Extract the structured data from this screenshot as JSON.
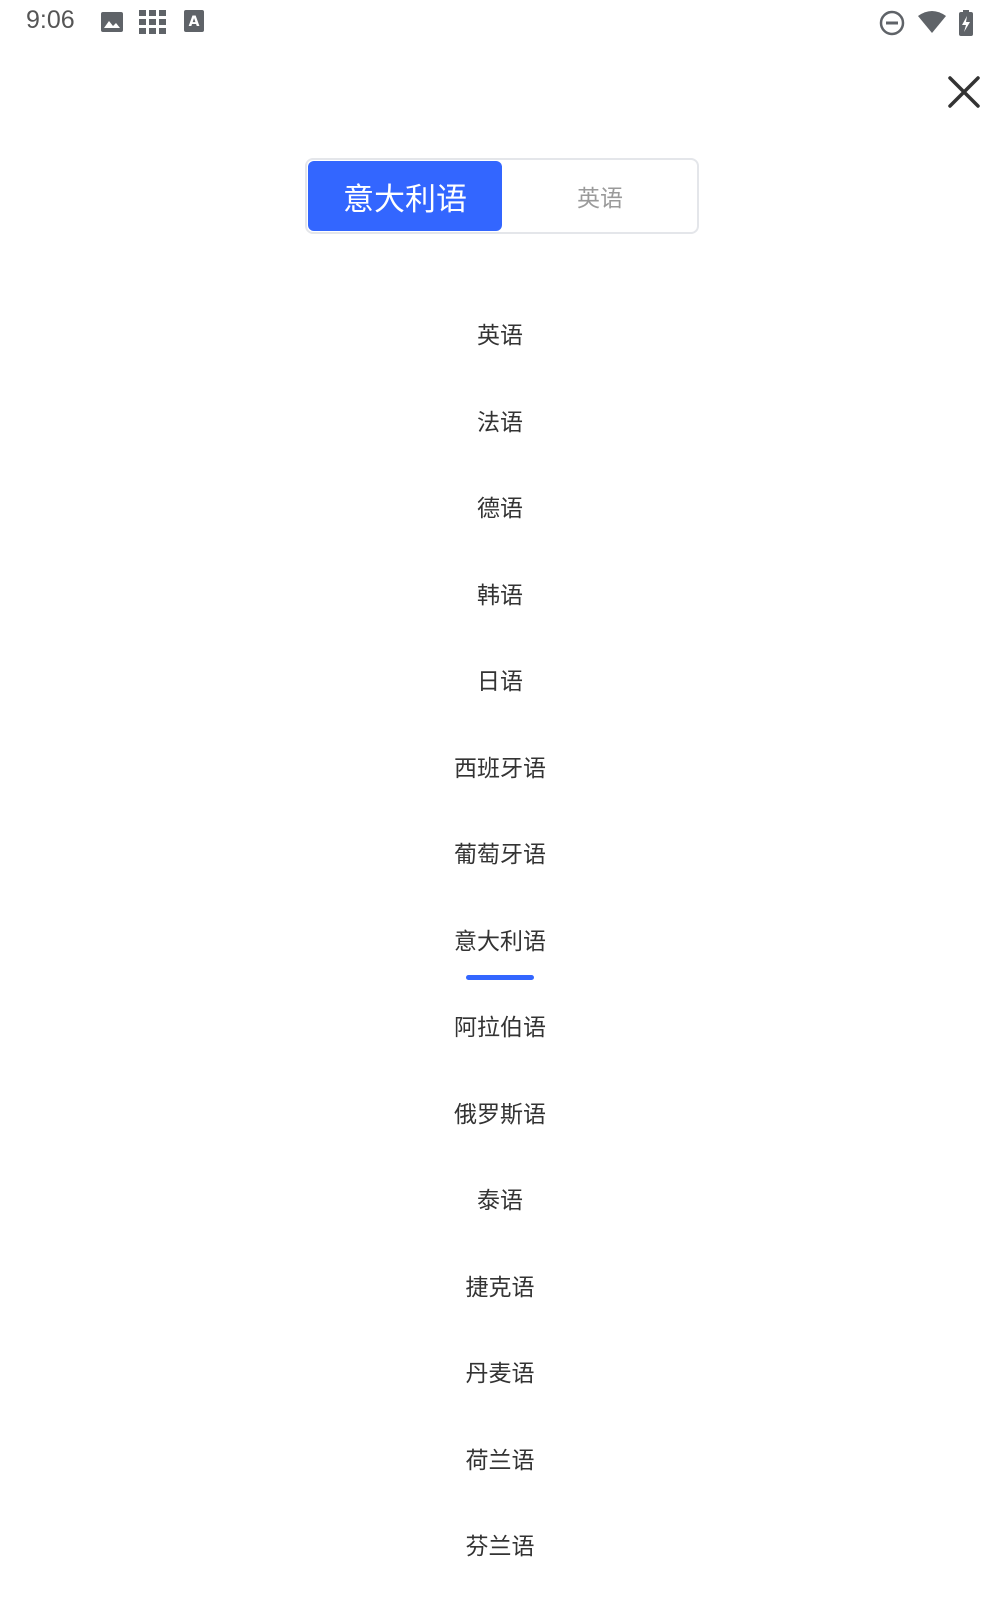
{
  "status_bar": {
    "time": "9:06",
    "icons": [
      "image-icon",
      "apps-grid-icon",
      "keyboard-a-icon",
      "dnd-icon",
      "wifi-icon",
      "battery-charging-icon"
    ]
  },
  "toggle": {
    "source": "意大利语",
    "target": "英语",
    "active_color": "#3366ff"
  },
  "languages": [
    {
      "label": "英语",
      "selected": false
    },
    {
      "label": "法语",
      "selected": false
    },
    {
      "label": "德语",
      "selected": false
    },
    {
      "label": "韩语",
      "selected": false
    },
    {
      "label": "日语",
      "selected": false
    },
    {
      "label": "西班牙语",
      "selected": false
    },
    {
      "label": "葡萄牙语",
      "selected": false
    },
    {
      "label": "意大利语",
      "selected": true
    },
    {
      "label": "阿拉伯语",
      "selected": false
    },
    {
      "label": "俄罗斯语",
      "selected": false
    },
    {
      "label": "泰语",
      "selected": false
    },
    {
      "label": "捷克语",
      "selected": false
    },
    {
      "label": "丹麦语",
      "selected": false
    },
    {
      "label": "荷兰语",
      "selected": false
    },
    {
      "label": "芬兰语",
      "selected": false
    }
  ]
}
